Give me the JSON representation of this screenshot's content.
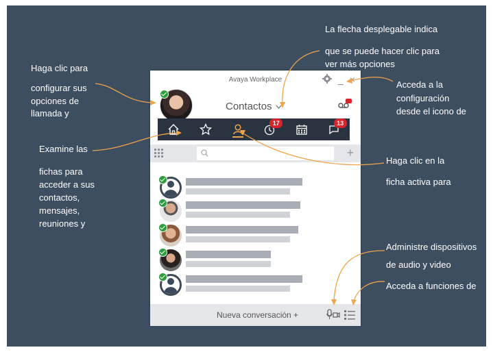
{
  "callouts": {
    "dropdown_line1": "La flecha desplegable  indica",
    "dropdown_line2": "que se puede hacer clic para",
    "dropdown_line3": "ver más opciones",
    "avatar_line1": "Haga clic para",
    "avatar_line2": "configurar sus",
    "avatar_line3": "opciones  de",
    "avatar_line4": "llamada y",
    "settings_line1": "Acceda  a la",
    "settings_line2": "configuración",
    "settings_line3": "desde el icono de",
    "tabs_line1": "Examine las",
    "tabs_line2": "fichas para",
    "tabs_line3": "acceder a sus",
    "tabs_line4": "contactos,",
    "tabs_line5": "mensajes,",
    "tabs_line6": "reuniones y",
    "active_line1": "Haga clic en la",
    "active_line2": "ficha activa para",
    "audio_line1": "Administre  dispositivos",
    "audio_line2": "de audio y video",
    "functions_line1": "Acceda  a funciones de"
  },
  "app": {
    "window_title": "Avaya Workplace",
    "title": "Contactos",
    "minimize": "_",
    "close": "×",
    "tabs": [
      {
        "name": "home",
        "badge": ""
      },
      {
        "name": "favorites",
        "badge": ""
      },
      {
        "name": "contacts",
        "badge": ""
      },
      {
        "name": "history",
        "badge": "17"
      },
      {
        "name": "calendar",
        "badge": ""
      },
      {
        "name": "messages",
        "badge": "13"
      }
    ],
    "search_placeholder": "",
    "add_label": "+",
    "footer_label": "Nueva conversación +"
  },
  "contacts": [
    {
      "avatar": "generic",
      "presence": "available",
      "name_fill": 0.62,
      "detail_fill": 0.55
    },
    {
      "avatar": "photo",
      "presence": "available",
      "name_fill": 0.6,
      "detail_fill": 0.55
    },
    {
      "avatar": "photo",
      "presence": "available",
      "name_fill": 0.59,
      "detail_fill": 0.55
    },
    {
      "avatar": "photo",
      "presence": "available",
      "name_fill": 0.44,
      "detail_fill": 0.44
    },
    {
      "avatar": "generic",
      "presence": "available",
      "name_fill": 0.62,
      "detail_fill": 0.55
    }
  ],
  "colors": {
    "background": "#3d4e61",
    "callout_arrow": "#f0a44b",
    "tab_bar": "#2a3440",
    "badge": "#d9242c",
    "presence": "#2e9d3e"
  }
}
